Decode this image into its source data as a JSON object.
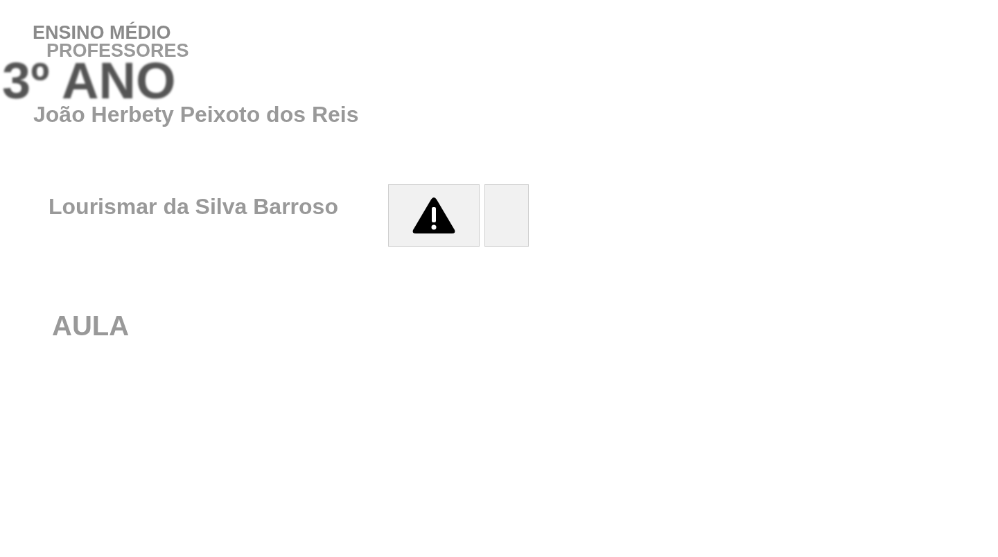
{
  "header": {
    "level": "ENSINO MÉDIO",
    "section": "PROFESSORES",
    "grade": "3º ANO"
  },
  "teachers": [
    {
      "name": "João Herbety Peixoto dos Reis"
    },
    {
      "name": "Lourismar da Silva Barroso",
      "buttons": [
        {
          "kind": "warning"
        },
        {
          "kind": "blank"
        }
      ]
    }
  ],
  "subheading": "AULA"
}
